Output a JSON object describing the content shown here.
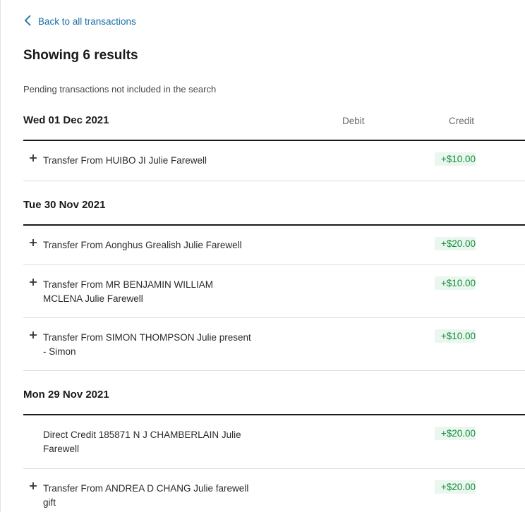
{
  "nav": {
    "back_label": "Back to all transactions"
  },
  "header": {
    "title": "Showing 6 results",
    "note": "Pending transactions not included in the search"
  },
  "columns": {
    "debit": "Debit",
    "credit": "Credit"
  },
  "groups": [
    {
      "date": "Wed 01 Dec 2021",
      "transactions": [
        {
          "description": "Transfer From HUIBO JI Julie Farewell",
          "credit": "+$10.00",
          "expandable": true
        }
      ]
    },
    {
      "date": "Tue 30 Nov 2021",
      "transactions": [
        {
          "description": "Transfer From Aonghus Grealish Julie Farewell",
          "credit": "+$20.00",
          "expandable": true
        },
        {
          "description": "Transfer From MR BENJAMIN WILLIAM MCLENA Julie Farewell",
          "credit": "+$10.00",
          "expandable": true
        },
        {
          "description": "Transfer From SIMON THOMPSON Julie present - Simon",
          "credit": "+$10.00",
          "expandable": true
        }
      ]
    },
    {
      "date": "Mon 29 Nov 2021",
      "transactions": [
        {
          "description": "Direct Credit 185871 N J CHAMBERLAIN Julie Farewell",
          "credit": "+$20.00",
          "expandable": false
        },
        {
          "description": "Transfer From ANDREA D CHANG Julie farewell gift",
          "credit": "+$20.00",
          "expandable": true
        }
      ]
    }
  ],
  "icons": {
    "back": "chevron-left-icon",
    "expand": "plus-icon"
  },
  "colors": {
    "link": "#1a6fa8",
    "credit_text": "#138a3b",
    "credit_bg": "#eaf7ee"
  }
}
